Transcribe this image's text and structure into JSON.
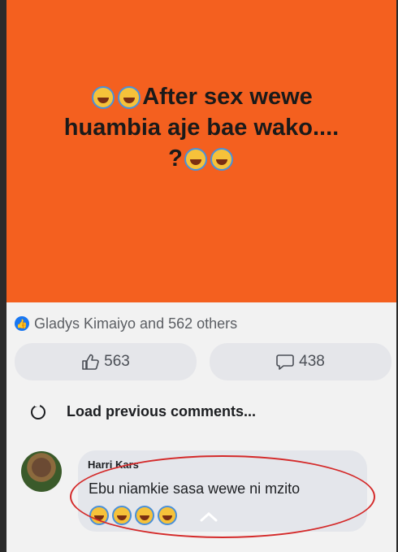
{
  "post": {
    "line1": "After sex wewe",
    "line2": "huambia aje bae wako....",
    "line3": "?",
    "background_color": "#f4601f"
  },
  "reactions": {
    "summary": "Gladys Kimaiyo and 562 others",
    "like_count": "563",
    "comment_count": "438",
    "like_icon": "thumbs-up-icon",
    "comment_icon": "speech-bubble-icon"
  },
  "comments": {
    "load_previous": "Load previous comments...",
    "items": [
      {
        "author": "Harri Kars",
        "text": "Ebu niamkie sasa wewe ni mzito"
      }
    ]
  }
}
